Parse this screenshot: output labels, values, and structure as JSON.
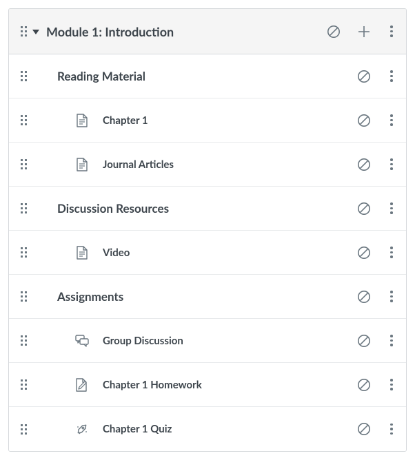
{
  "module": {
    "title": "Module 1: Introduction",
    "items": [
      {
        "type": "subheader",
        "label": "Reading Material"
      },
      {
        "type": "page",
        "label": "Chapter 1"
      },
      {
        "type": "page",
        "label": "Journal Articles"
      },
      {
        "type": "subheader",
        "label": "Discussion Resources"
      },
      {
        "type": "page",
        "label": "Video"
      },
      {
        "type": "subheader",
        "label": "Assignments"
      },
      {
        "type": "discussion",
        "label": "Group Discussion"
      },
      {
        "type": "assignment",
        "label": "Chapter 1 Homework"
      },
      {
        "type": "quiz",
        "label": "Chapter 1 Quiz"
      }
    ]
  }
}
